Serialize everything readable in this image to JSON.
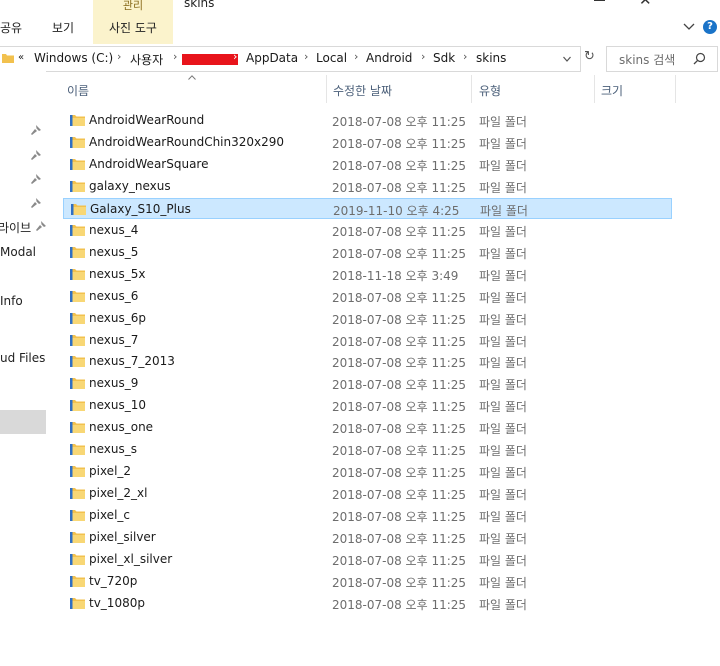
{
  "ribbon": {
    "tabs": [
      "공유",
      "보기"
    ],
    "manage_group_label": "관리",
    "manage_tab": "사진 도구",
    "window_title": "skins"
  },
  "address": {
    "overflow": "«",
    "crumbs": [
      "Windows (C:)",
      "사용자",
      "AppData",
      "Local",
      "Android",
      "Sdk",
      "skins"
    ],
    "separator": "›"
  },
  "search": {
    "placeholder": "skins 검색"
  },
  "nav": {
    "items": [
      "라이브",
      "Modal",
      "Info",
      "ud Files"
    ]
  },
  "columns": [
    "이름",
    "수정한 날짜",
    "유형",
    "크기"
  ],
  "files": [
    {
      "name": "AndroidWearRound",
      "date": "2018-07-08 오후 11:25",
      "type": "파일 폴더"
    },
    {
      "name": "AndroidWearRoundChin320x290",
      "date": "2018-07-08 오후 11:25",
      "type": "파일 폴더"
    },
    {
      "name": "AndroidWearSquare",
      "date": "2018-07-08 오후 11:25",
      "type": "파일 폴더"
    },
    {
      "name": "galaxy_nexus",
      "date": "2018-07-08 오후 11:25",
      "type": "파일 폴더"
    },
    {
      "name": "Galaxy_S10_Plus",
      "date": "2019-11-10 오후 4:25",
      "type": "파일 폴더",
      "selected": true
    },
    {
      "name": "nexus_4",
      "date": "2018-07-08 오후 11:25",
      "type": "파일 폴더"
    },
    {
      "name": "nexus_5",
      "date": "2018-07-08 오후 11:25",
      "type": "파일 폴더"
    },
    {
      "name": "nexus_5x",
      "date": "2018-11-18 오후 3:49",
      "type": "파일 폴더"
    },
    {
      "name": "nexus_6",
      "date": "2018-07-08 오후 11:25",
      "type": "파일 폴더"
    },
    {
      "name": "nexus_6p",
      "date": "2018-07-08 오후 11:25",
      "type": "파일 폴더"
    },
    {
      "name": "nexus_7",
      "date": "2018-07-08 오후 11:25",
      "type": "파일 폴더"
    },
    {
      "name": "nexus_7_2013",
      "date": "2018-07-08 오후 11:25",
      "type": "파일 폴더"
    },
    {
      "name": "nexus_9",
      "date": "2018-07-08 오후 11:25",
      "type": "파일 폴더"
    },
    {
      "name": "nexus_10",
      "date": "2018-07-08 오후 11:25",
      "type": "파일 폴더"
    },
    {
      "name": "nexus_one",
      "date": "2018-07-08 오후 11:25",
      "type": "파일 폴더"
    },
    {
      "name": "nexus_s",
      "date": "2018-07-08 오후 11:25",
      "type": "파일 폴더"
    },
    {
      "name": "pixel_2",
      "date": "2018-07-08 오후 11:25",
      "type": "파일 폴더"
    },
    {
      "name": "pixel_2_xl",
      "date": "2018-07-08 오후 11:25",
      "type": "파일 폴더"
    },
    {
      "name": "pixel_c",
      "date": "2018-07-08 오후 11:25",
      "type": "파일 폴더"
    },
    {
      "name": "pixel_silver",
      "date": "2018-07-08 오후 11:25",
      "type": "파일 폴더"
    },
    {
      "name": "pixel_xl_silver",
      "date": "2018-07-08 오후 11:25",
      "type": "파일 폴더"
    },
    {
      "name": "tv_720p",
      "date": "2018-07-08 오후 11:25",
      "type": "파일 폴더"
    },
    {
      "name": "tv_1080p",
      "date": "2018-07-08 오후 11:25",
      "type": "파일 폴더"
    }
  ],
  "colors": {
    "folder": "#f2c14e",
    "selection": "#cce8ff",
    "header_text": "#4c607a",
    "help": "#1a73c8"
  }
}
